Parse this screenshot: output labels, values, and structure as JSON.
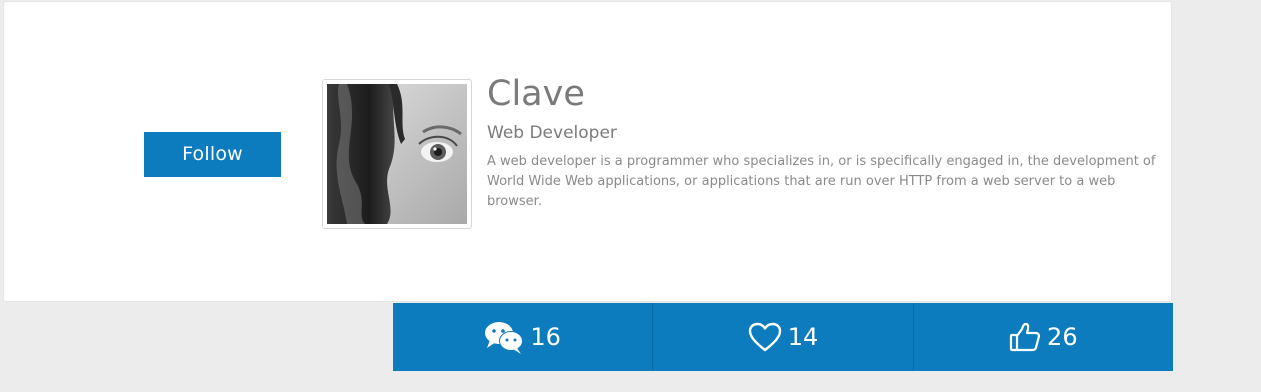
{
  "profile": {
    "name": "Clave",
    "role": "Web Developer",
    "bio": "A web developer is a programmer who specializes in, or is specifically engaged in, the development of World Wide Web applications, or applications that are run over HTTP from a web server to a web browser.",
    "follow_label": "Follow"
  },
  "stats": {
    "comments": "16",
    "likes": "14",
    "thumbs_up": "26"
  },
  "icons": {
    "comments": "comments-icon",
    "likes": "heart-icon",
    "thumbs_up": "thumbs-up-icon"
  },
  "colors": {
    "accent": "#0c7cbf",
    "background": "#ececec",
    "card": "#ffffff",
    "text_name": "#7a7a7a",
    "text_bio": "#8a8a8a"
  }
}
